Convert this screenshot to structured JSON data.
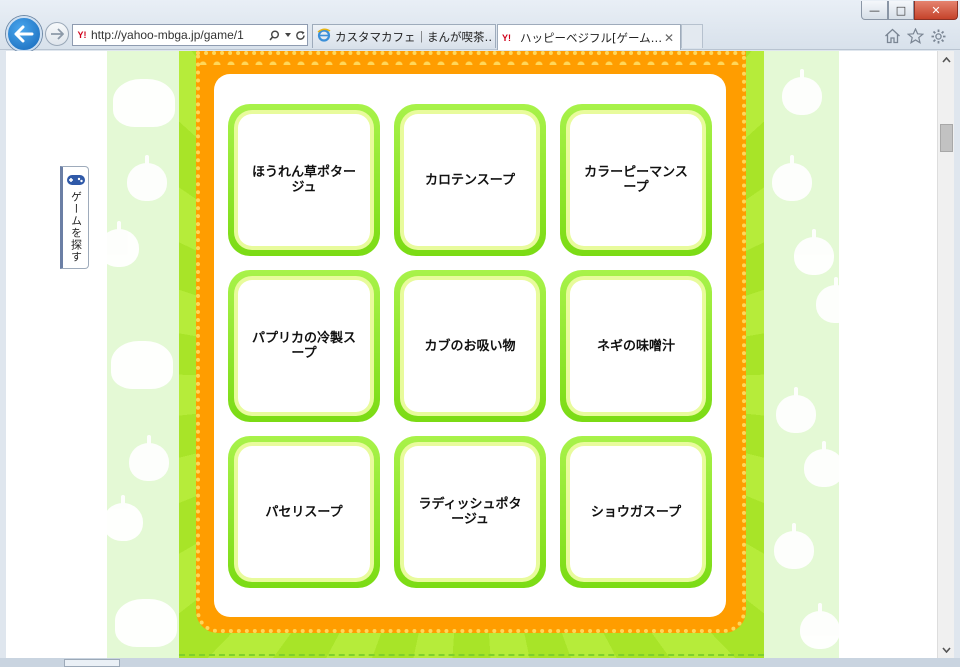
{
  "browser": {
    "address_url": "http://yahoo-mbga.jp/game/1",
    "address_favicon": "Y!",
    "tabs": [
      {
        "label": "カスタマカフェ｜まんが喫茶…",
        "icon": "ie-icon"
      },
      {
        "label": "ハッピーベジフル[ゲーム…",
        "icon": "yahoo-icon",
        "active": true
      }
    ],
    "window_buttons": [
      "minimize",
      "maximize",
      "close"
    ],
    "toolbar_icons": [
      "home-icon",
      "star-icon",
      "gear-icon"
    ]
  },
  "sidebar": {
    "label": "ゲームを探す",
    "icon": "gamepad-icon"
  },
  "menu": {
    "items": [
      {
        "label": "ほうれん草ポタージュ"
      },
      {
        "label": "カロテンスープ"
      },
      {
        "label": "カラーピーマンスープ"
      },
      {
        "label": "パプリカの冷製スープ"
      },
      {
        "label": "カブのお吸い物"
      },
      {
        "label": "ネギの味噌汁"
      },
      {
        "label": "パセリスープ"
      },
      {
        "label": "ラディッシュポタージュ"
      },
      {
        "label": "ショウガスープ"
      }
    ]
  },
  "colors": {
    "frame_orange": "#ff9d00",
    "card_green": "#7bdb14",
    "background_green": "#b6ec3a",
    "side_pastel": "#e4f9d5"
  }
}
